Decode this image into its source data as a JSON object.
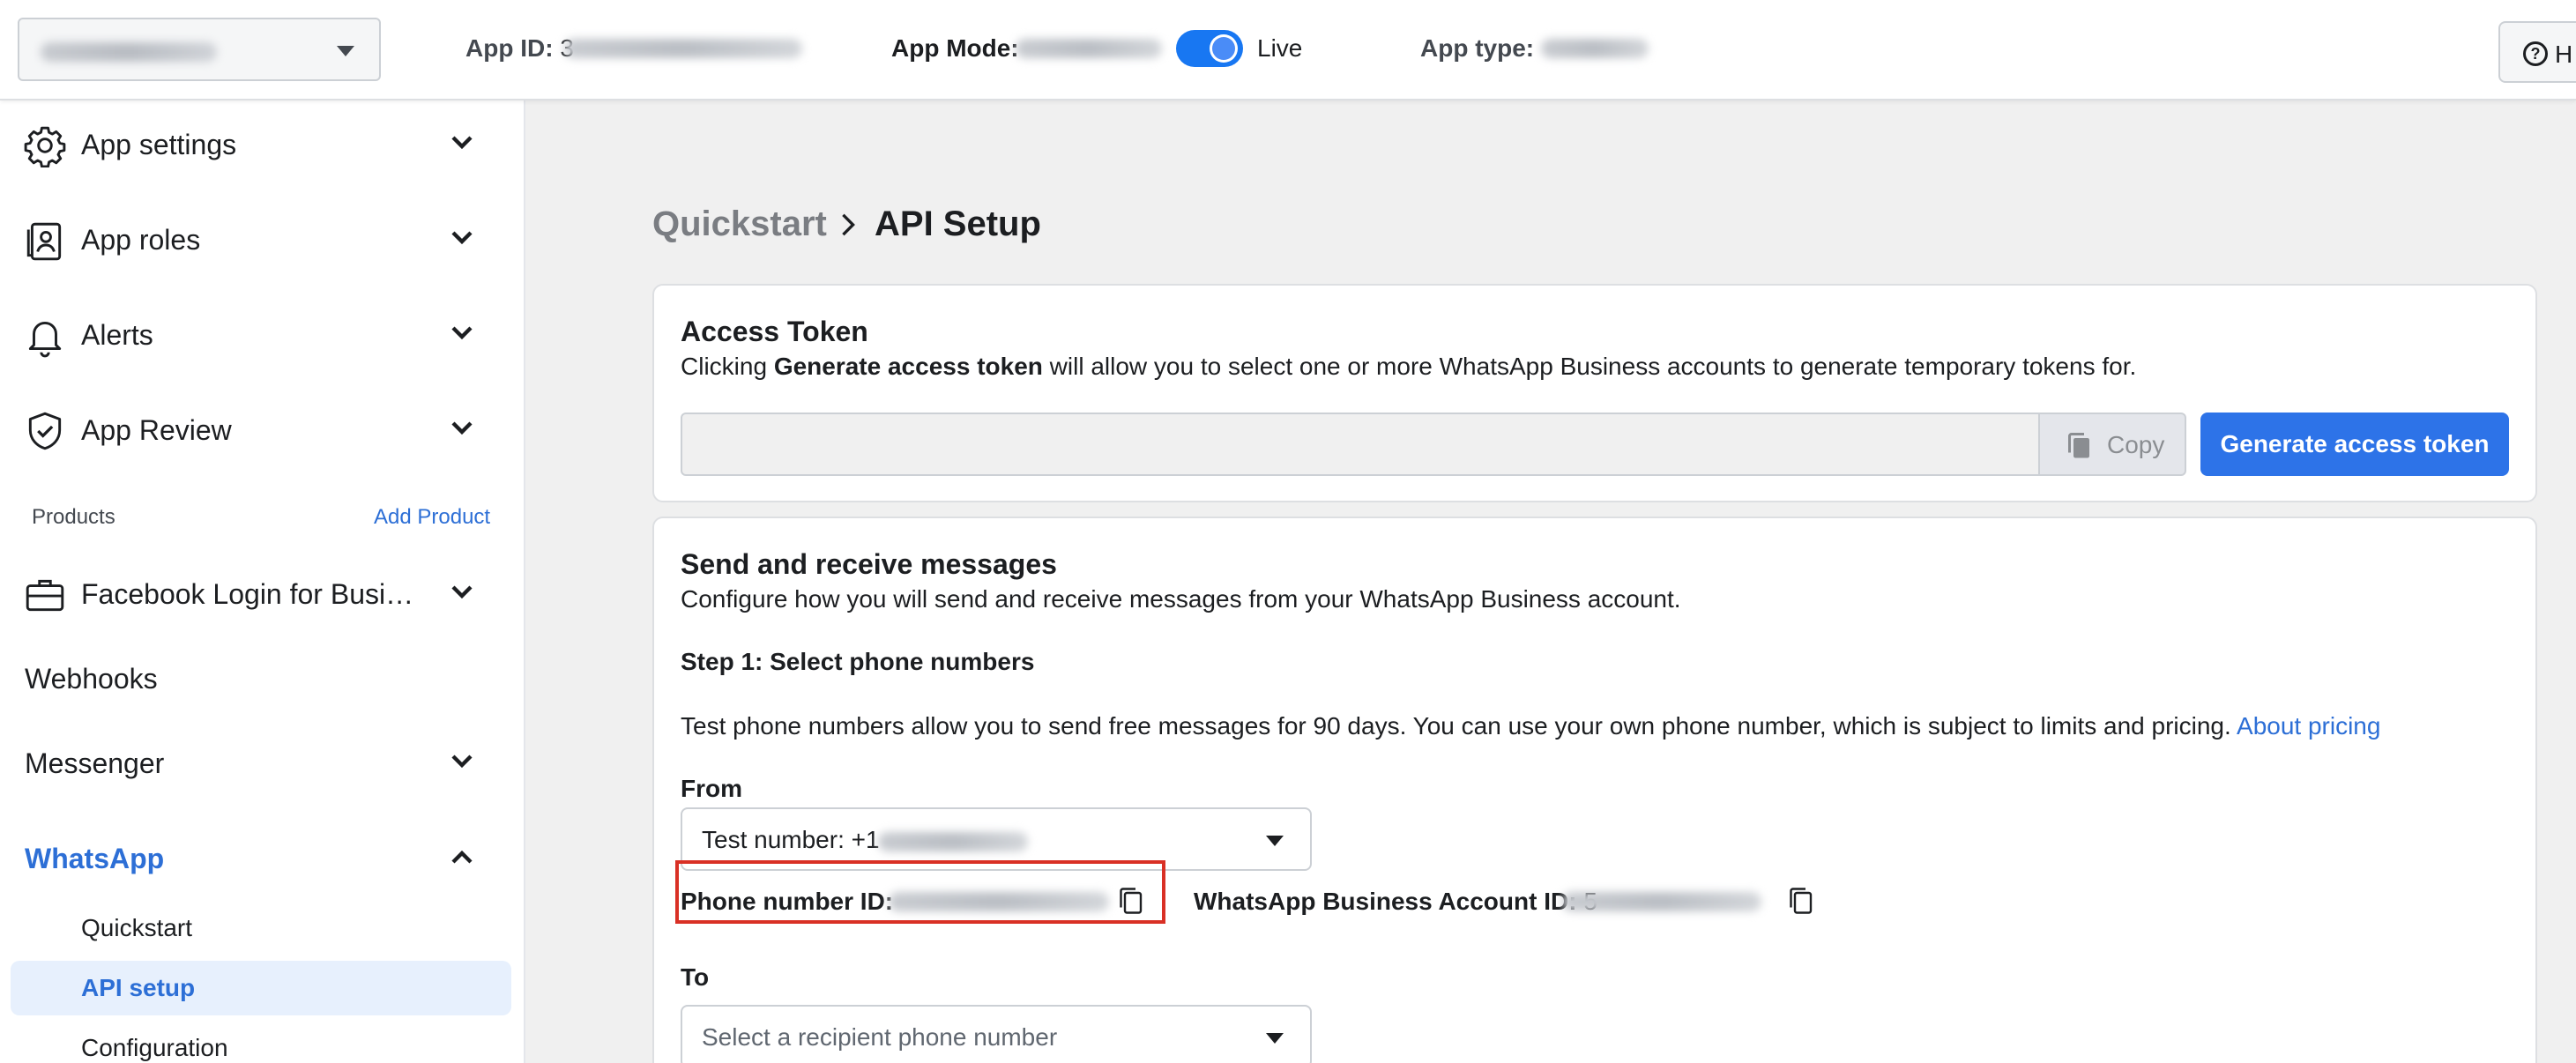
{
  "topbar": {
    "app_id_label": "App ID:",
    "app_id_value": "3",
    "app_mode_label": "App Mode:",
    "live_label": "Live",
    "app_type_label": "App type:",
    "help_label": "H"
  },
  "sidebar": {
    "items": [
      {
        "label": "App settings"
      },
      {
        "label": "App roles"
      },
      {
        "label": "Alerts"
      },
      {
        "label": "App Review"
      }
    ],
    "products_header": "Products",
    "add_product": "Add Product",
    "products": [
      {
        "label": "Facebook Login for Busi…"
      },
      {
        "label": "Webhooks"
      },
      {
        "label": "Messenger"
      },
      {
        "label": "WhatsApp"
      }
    ],
    "whatsapp_subitems": [
      {
        "label": "Quickstart"
      },
      {
        "label": "API setup"
      },
      {
        "label": "Configuration"
      }
    ]
  },
  "breadcrumb": {
    "parent": "Quickstart",
    "current": "API Setup"
  },
  "access_token": {
    "title": "Access Token",
    "desc_prefix": "Clicking ",
    "desc_bold": "Generate access token",
    "desc_suffix": " will allow you to select one or more WhatsApp Business accounts to generate temporary tokens for.",
    "copy_label": "Copy",
    "generate_label": "Generate access token"
  },
  "messages": {
    "title": "Send and receive messages",
    "desc": "Configure how you will send and receive messages from your WhatsApp Business account.",
    "step1": "Step 1: Select phone numbers",
    "info_text": "Test phone numbers allow you to send free messages for 90 days. You can use your own phone number, which is subject to limits and pricing. ",
    "about_pricing": "About pricing",
    "from_label": "From",
    "from_value": "Test number: +1",
    "phone_id_label": "Phone number ID:",
    "waba_id_label": "WhatsApp Business Account ID:",
    "waba_id_value": "5",
    "to_label": "To",
    "to_placeholder": "Select a recipient phone number"
  },
  "colors": {
    "accent": "#2d73e8",
    "link": "#2d6fd6",
    "highlight": "#d93025",
    "active_bg": "#e7f0fd"
  }
}
